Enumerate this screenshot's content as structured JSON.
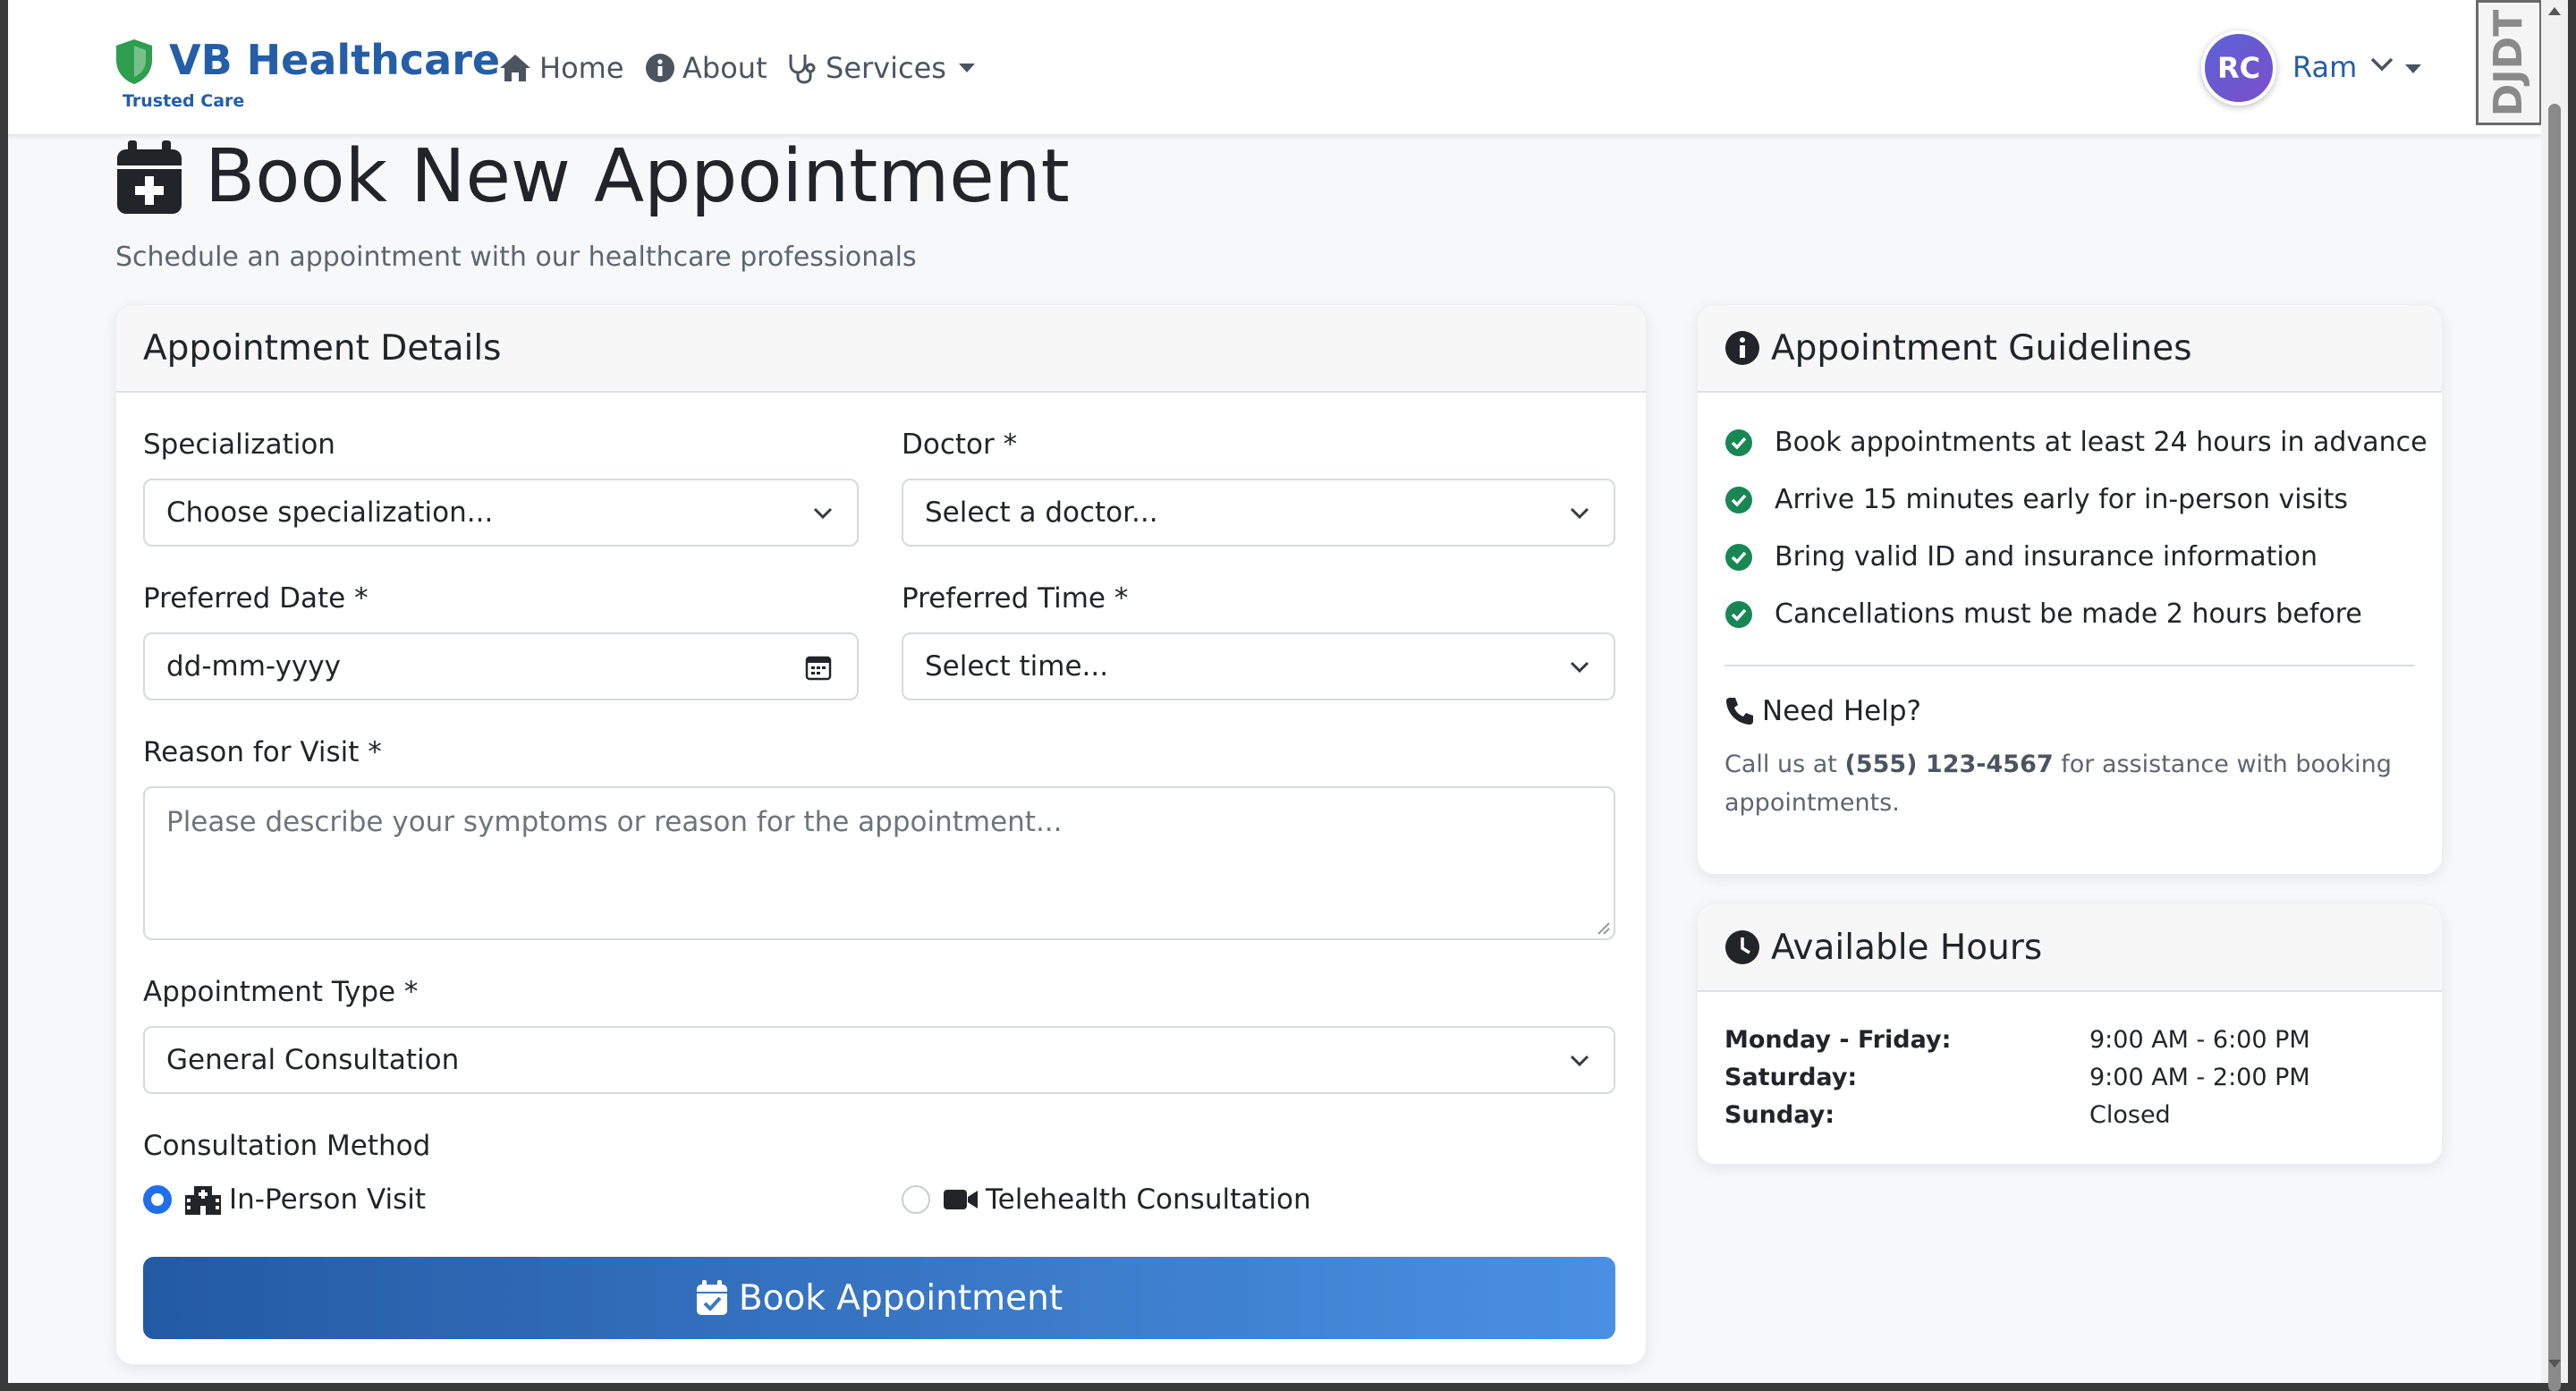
{
  "navbar": {
    "brand_name": "VB Healthcare",
    "brand_tagline": "Trusted Care",
    "brand_color": "#245ea7",
    "shield_color": "#2e9e4f",
    "links": [
      {
        "label": "Home",
        "icon": "home-icon"
      },
      {
        "label": "About",
        "icon": "info-icon"
      },
      {
        "label": "Services",
        "icon": "stethoscope-icon"
      }
    ],
    "user": {
      "initials": "RC",
      "name": "Ram"
    }
  },
  "page": {
    "title": "Book New Appointment",
    "subtitle": "Schedule an appointment with our healthcare professionals"
  },
  "form": {
    "header": "Appointment Details",
    "specialization": {
      "label": "Specialization",
      "value": "Choose specialization..."
    },
    "doctor": {
      "label": "Doctor *",
      "value": "Select a doctor..."
    },
    "date": {
      "label": "Preferred Date *",
      "value": "dd-mm-yyyy"
    },
    "time": {
      "label": "Preferred Time *",
      "value": "Select time..."
    },
    "reason": {
      "label": "Reason for Visit *",
      "placeholder": "Please describe your symptoms or reason for the appointment..."
    },
    "type": {
      "label": "Appointment Type *",
      "value": "General Consultation"
    },
    "method": {
      "label": "Consultation Method",
      "options": [
        {
          "label": "In-Person Visit",
          "icon": "hospital-icon",
          "selected": true
        },
        {
          "label": "Telehealth Consultation",
          "icon": "video-icon",
          "selected": false
        }
      ]
    },
    "submit_label": "Book Appointment",
    "accent": "#1f6feb"
  },
  "guidelines": {
    "header": "Appointment Guidelines",
    "items": [
      "Book appointments at least 24 hours in advance",
      "Arrive 15 minutes early for in-person visits",
      "Bring valid ID and insurance information",
      "Cancellations must be made 2 hours before"
    ],
    "check_color": "#198754",
    "help_title": "Need Help?",
    "help_prefix": "Call us at",
    "help_phone": "(555) 123-4567",
    "help_suffix": "for assistance with booking appointments."
  },
  "hours": {
    "header": "Available Hours",
    "rows": [
      {
        "day": "Monday - Friday:",
        "time": "9:00 AM - 6:00 PM"
      },
      {
        "day": "Saturday:",
        "time": "9:00 AM - 2:00 PM"
      },
      {
        "day": "Sunday:",
        "time": "Closed"
      }
    ]
  },
  "badge": {
    "text": "DJDT"
  }
}
